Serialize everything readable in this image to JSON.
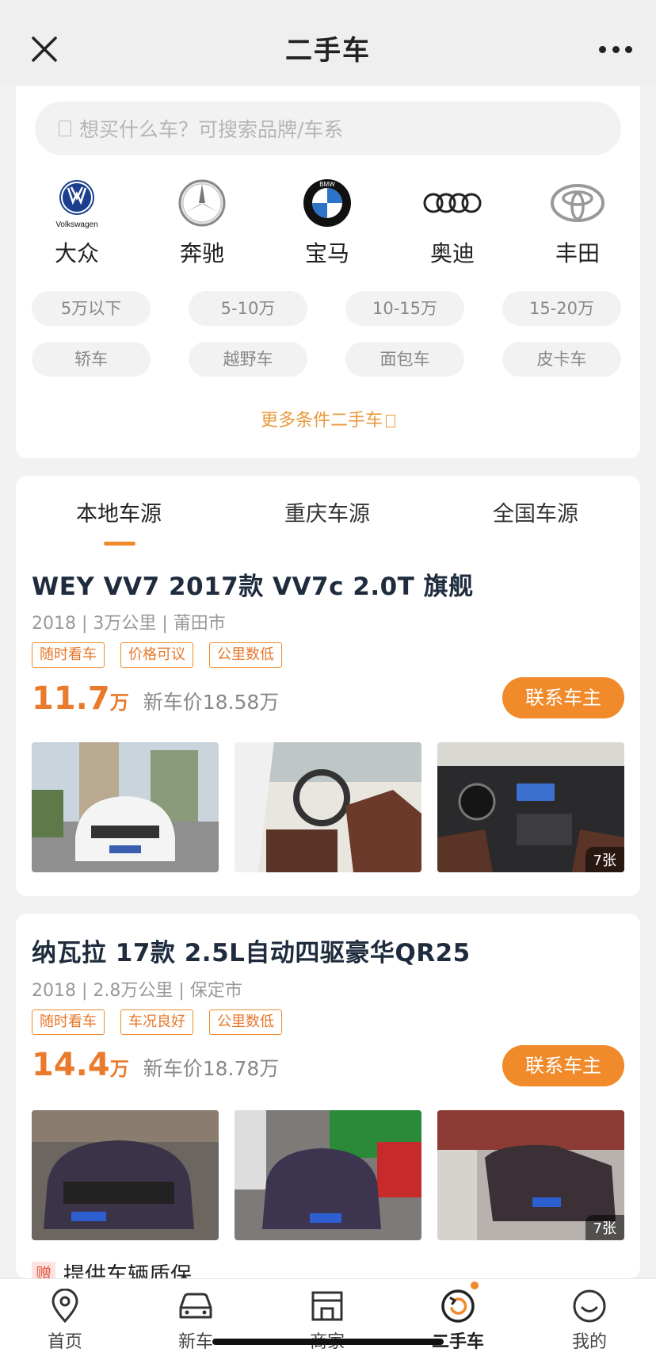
{
  "nav": {
    "title": "二手车"
  },
  "search": {
    "placeholder": "想买什么车？可搜索品牌/车系"
  },
  "brands": [
    {
      "label": "大众",
      "logo_text": "Volkswagen",
      "icon": "volkswagen-logo"
    },
    {
      "label": "奔驰",
      "icon": "mercedes-logo"
    },
    {
      "label": "宝马",
      "logo_text": "BMW",
      "icon": "bmw-logo"
    },
    {
      "label": "奥迪",
      "icon": "audi-logo"
    },
    {
      "label": "丰田",
      "icon": "toyota-logo"
    }
  ],
  "price_filters": [
    "5万以下",
    "5-10万",
    "10-15万",
    "15-20万"
  ],
  "type_filters": [
    "轿车",
    "越野车",
    "面包车",
    "皮卡车"
  ],
  "more_conditions": "更多条件二手车",
  "tabs": [
    {
      "label": "本地车源",
      "active": true
    },
    {
      "label": "重庆车源",
      "active": false
    },
    {
      "label": "全国车源",
      "active": false
    }
  ],
  "listings": [
    {
      "title": "WEY VV7 2017款 VV7c 2.0T 旗舰",
      "meta": "2018 | 3万公里 | 莆田市",
      "tags": [
        "随时看车",
        "价格可议",
        "公里数低"
      ],
      "price": "11.7",
      "price_unit": "万",
      "new_price": "新车价18.58万",
      "contact": "联系车主",
      "photo_count": "7张"
    },
    {
      "title": "纳瓦拉 17款 2.5L自动四驱豪华QR25",
      "meta": "2018 | 2.8万公里 | 保定市",
      "tags": [
        "随时看车",
        "车况良好",
        "公里数低"
      ],
      "price": "14.4",
      "price_unit": "万",
      "new_price": "新车价18.78万",
      "contact": "联系车主",
      "photo_count": "7张",
      "gift_badge": "赠",
      "gift_text": "提供车辆质保"
    }
  ],
  "tabbar": [
    {
      "label": "首页",
      "icon": "location-pin-icon"
    },
    {
      "label": "新车",
      "icon": "car-icon"
    },
    {
      "label": "商家",
      "icon": "store-icon"
    },
    {
      "label": "二手车",
      "icon": "used-car-icon",
      "active": true
    },
    {
      "label": "我的",
      "icon": "smile-icon"
    }
  ],
  "colors": {
    "accent": "#f08a2a",
    "title": "#1f2c3d"
  }
}
